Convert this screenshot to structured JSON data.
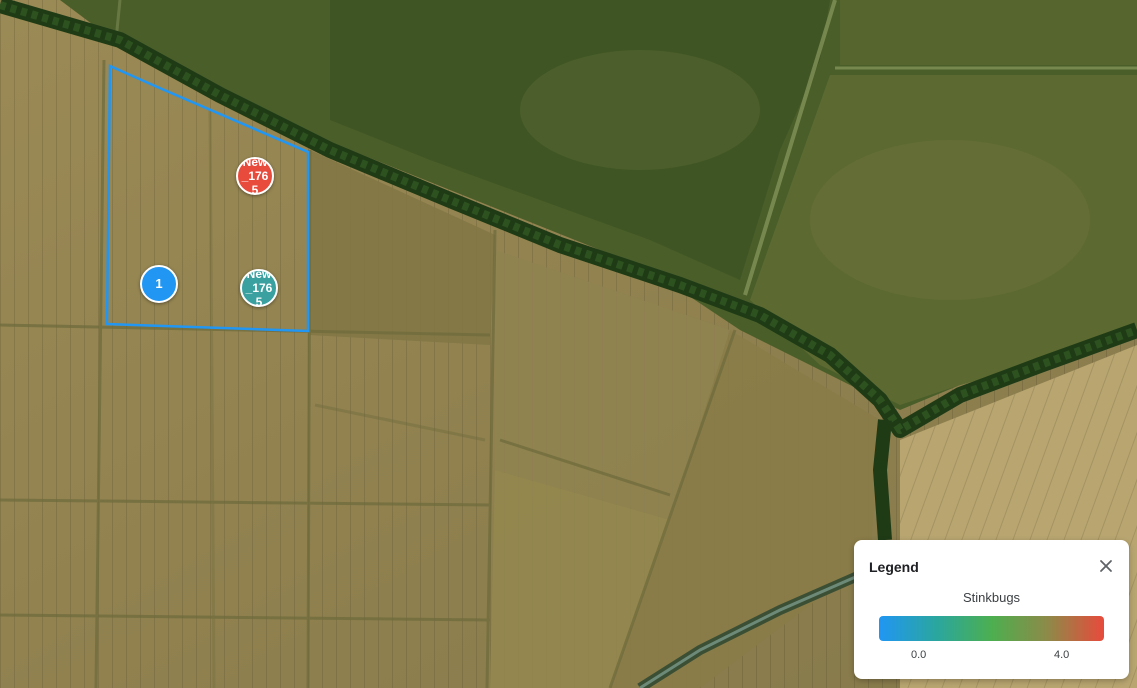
{
  "map": {
    "markers": [
      {
        "name": "cluster-marker",
        "label": "1",
        "color": "#2196f3"
      },
      {
        "name": "trap-marker-high",
        "label": "New_1765",
        "color": "#e84a3c"
      },
      {
        "name": "trap-marker-low",
        "label": "New_1765",
        "color": "#3aa0a0"
      }
    ],
    "field_boundary_color": "#2196f3"
  },
  "legend": {
    "title": "Legend",
    "series_name": "Stinkbugs",
    "min_label": "0.0",
    "max_label": "4.0",
    "gradient_colors": [
      "#2196f3",
      "#2aa6a0",
      "#4caf50",
      "#8d8a48",
      "#e84a3c"
    ],
    "close_icon": "close-icon"
  }
}
